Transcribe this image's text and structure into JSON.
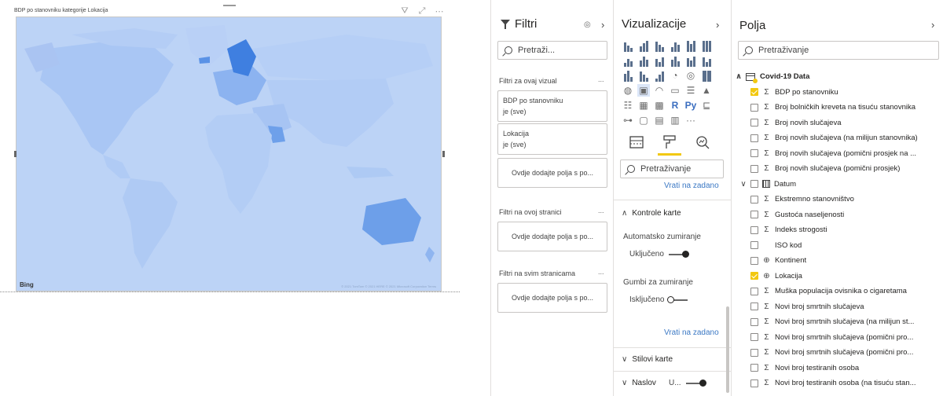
{
  "visual": {
    "title": "BDP po stanovniku kategorije Lokacija",
    "bing_label": "Bing",
    "attribution": "© 2021 TomTom © 2021 HERE © 2021 Microsoft Corporation  Terms"
  },
  "filters_pane": {
    "title": "Filtri",
    "search_placeholder": "Pretraži...",
    "section_visual": "Filtri za ovaj vizual",
    "cards": [
      {
        "name": "BDP po stanovniku",
        "state": "je (sve)"
      },
      {
        "name": "Lokacija",
        "state": "je (sve)"
      }
    ],
    "drop_label": "Ovdje dodajte polja s po...",
    "section_page": "Filtri na ovoj stranici",
    "section_all": "Filtri na svim stranicama",
    "more": "..."
  },
  "viz_pane": {
    "title": "Vizualizacije",
    "search_placeholder": "Pretraživanje",
    "reset_label": "Vrati na zadano",
    "map_controls": "Kontrole karte",
    "auto_zoom_label": "Automatsko zumiranje",
    "auto_zoom_state": "Uključeno",
    "zoom_buttons_label": "Gumbi za zumiranje",
    "zoom_buttons_state": "Isključeno",
    "map_styles": "Stilovi karte",
    "title_section": "Naslov",
    "title_state": "U...",
    "icon_r": "R",
    "icon_py": "Py",
    "icon_more": "···"
  },
  "fields_pane": {
    "title": "Polja",
    "search_placeholder": "Pretraživanje",
    "table_name": "Covid-19 Data",
    "fields": [
      {
        "label": "BDP po stanovniku",
        "icon": "sigma",
        "checked": true
      },
      {
        "label": "Broj bolničkih kreveta na tisuću stanovnika",
        "icon": "sigma",
        "checked": false
      },
      {
        "label": "Broj novih slučajeva",
        "icon": "sigma",
        "checked": false
      },
      {
        "label": "Broj novih slučajeva (na milijun stanovnika)",
        "icon": "sigma",
        "checked": false
      },
      {
        "label": "Broj novih slučajeva (pomični prosjek na ...",
        "icon": "sigma",
        "checked": false
      },
      {
        "label": "Broj novih slučajeva (pomični prosjek)",
        "icon": "sigma",
        "checked": false
      },
      {
        "label": "Datum",
        "icon": "calendar",
        "checked": false,
        "expandable": true
      },
      {
        "label": "Ekstremno stanovništvo",
        "icon": "sigma",
        "checked": false
      },
      {
        "label": "Gustoća naseljenosti",
        "icon": "sigma",
        "checked": false
      },
      {
        "label": "Indeks strogosti",
        "icon": "sigma",
        "checked": false
      },
      {
        "label": "ISO kod",
        "icon": "none",
        "checked": false
      },
      {
        "label": "Kontinent",
        "icon": "globe",
        "checked": false
      },
      {
        "label": "Lokacija",
        "icon": "globe",
        "checked": true
      },
      {
        "label": "Muška populacija ovisnika o cigaretama",
        "icon": "sigma",
        "checked": false
      },
      {
        "label": "Novi broj smrtnih slučajeva",
        "icon": "sigma",
        "checked": false
      },
      {
        "label": "Novi broj smrtnih slučajeva (na milijun st...",
        "icon": "sigma",
        "checked": false
      },
      {
        "label": "Novi broj smrtnih slučajeva (pomični pro...",
        "icon": "sigma",
        "checked": false
      },
      {
        "label": "Novi broj smrtnih slučajeva (pomični pro...",
        "icon": "sigma",
        "checked": false
      },
      {
        "label": "Novi broj testiranih osoba",
        "icon": "sigma",
        "checked": false
      },
      {
        "label": "Novi broj testiranih osoba (na tisuću stan...",
        "icon": "sigma",
        "checked": false
      }
    ]
  }
}
